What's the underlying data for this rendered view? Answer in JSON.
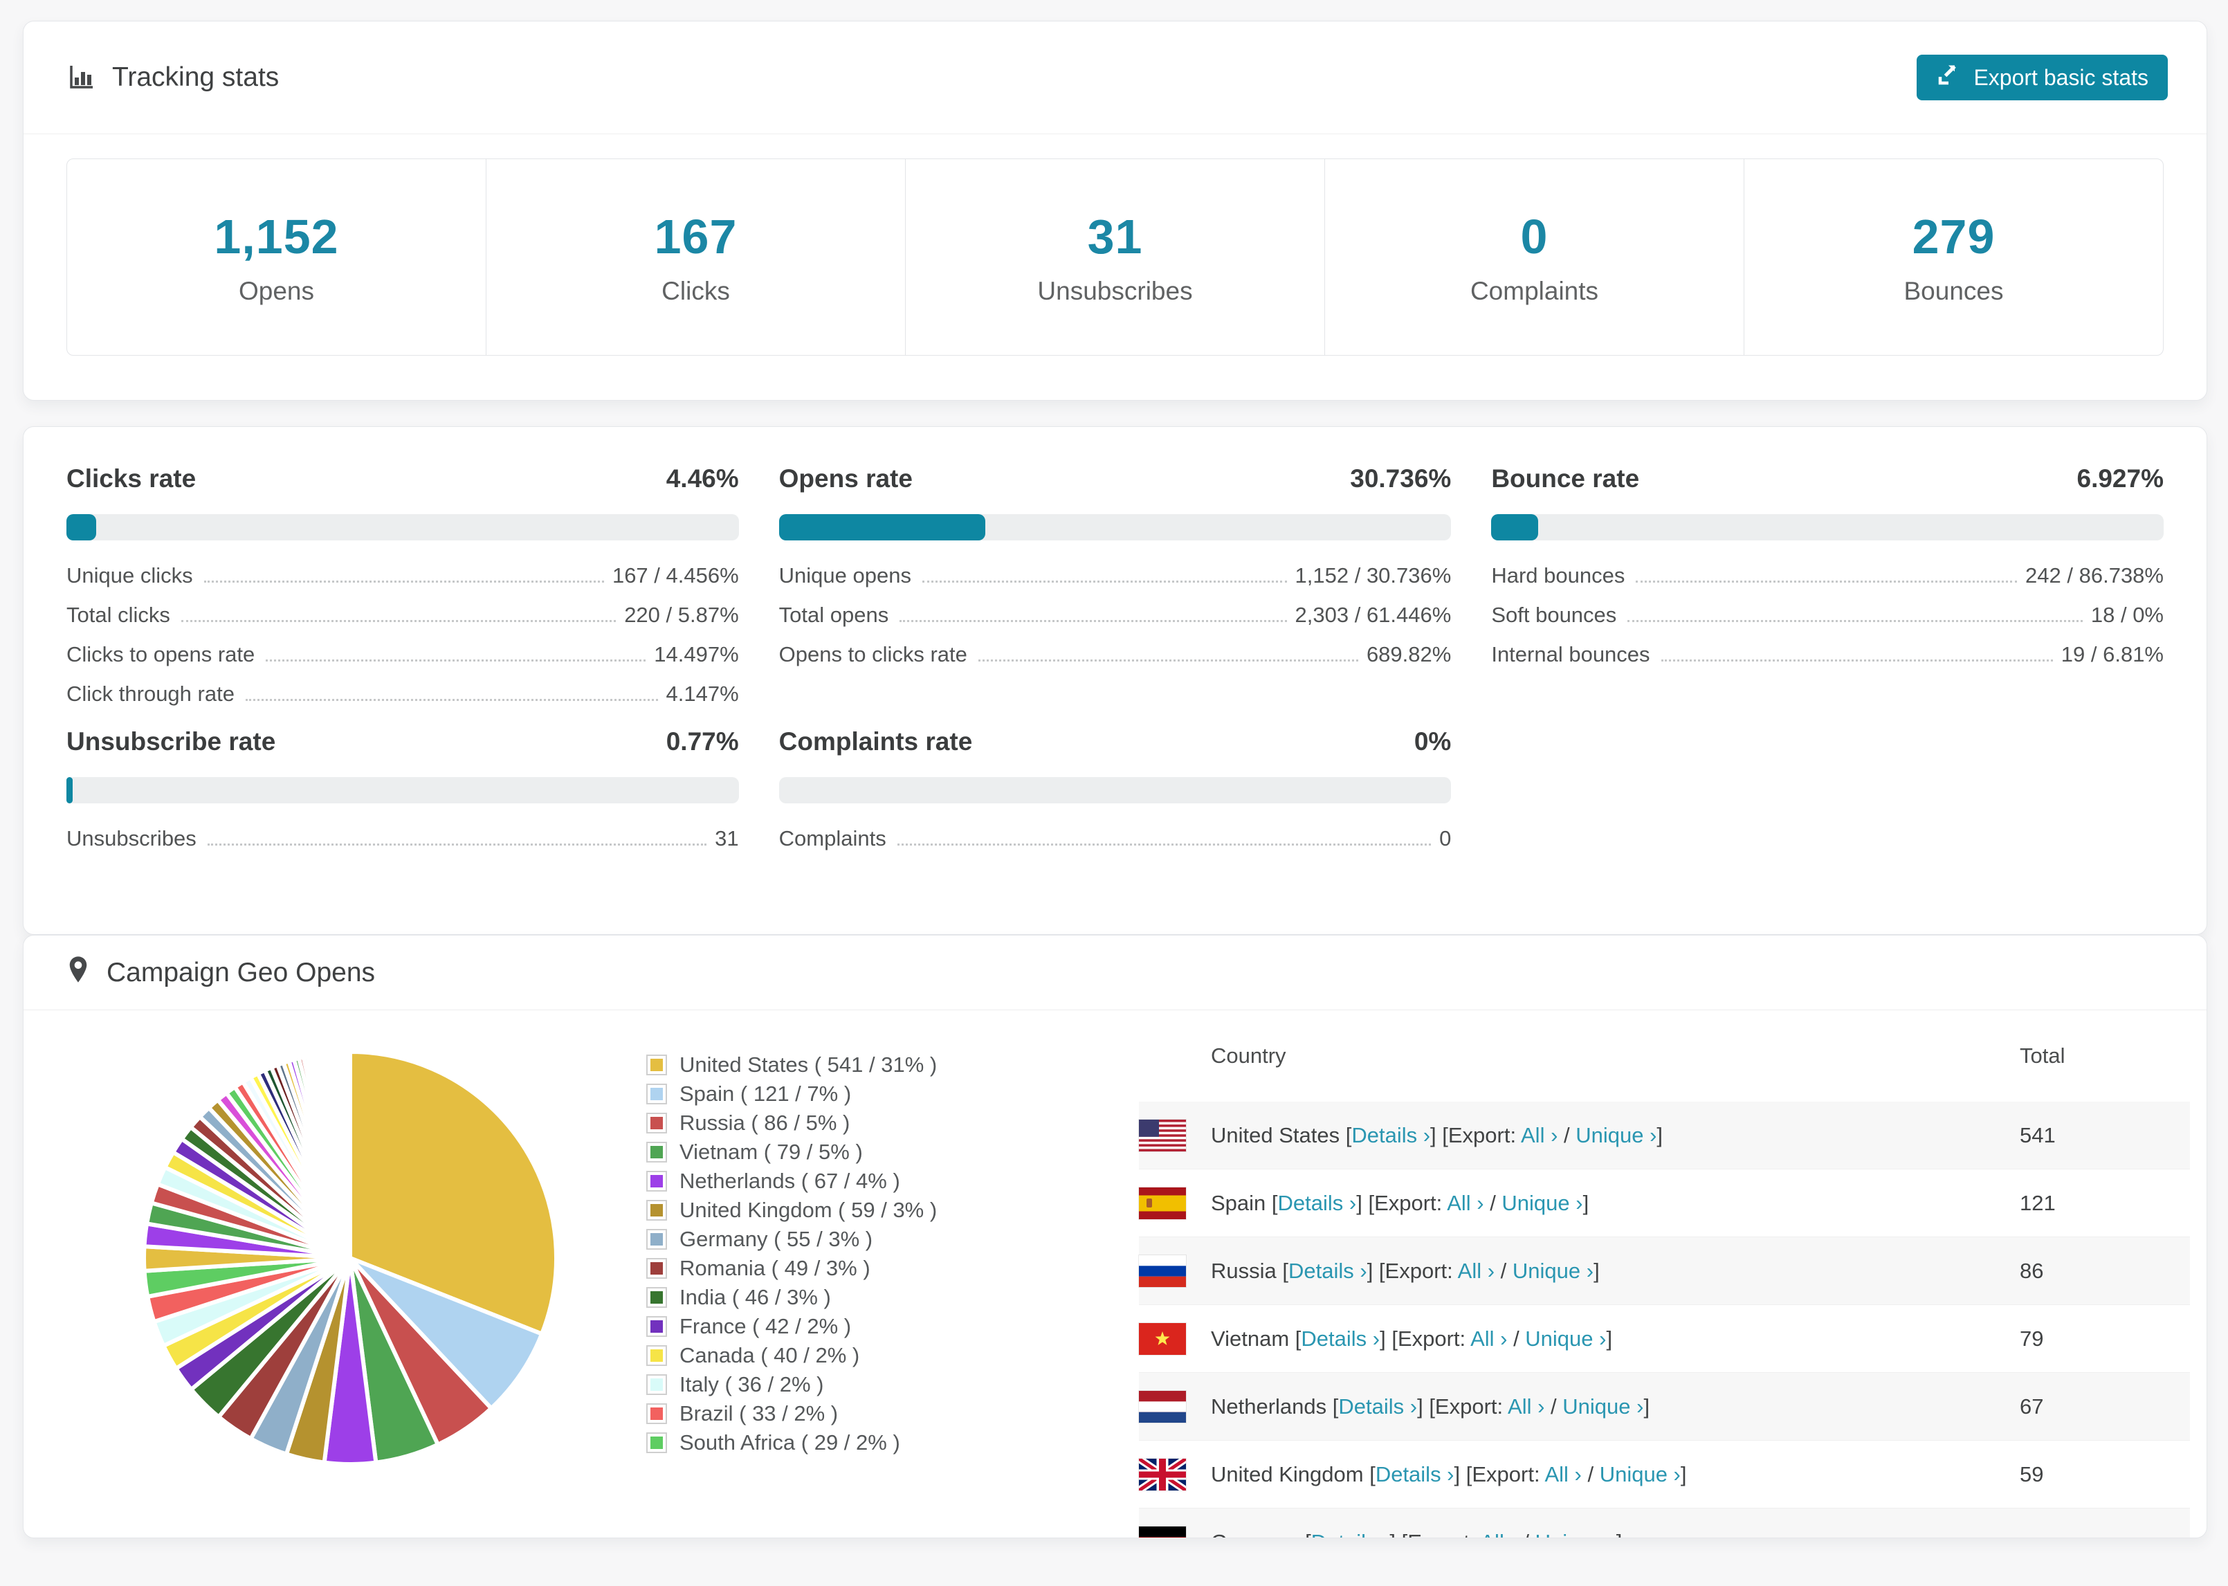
{
  "colors": {
    "accent": "#1B87A5",
    "button": "#0E87A2",
    "link": "#2A96B1",
    "bar_track": "#ECEEEF",
    "stripe_row": "#F7F7F7"
  },
  "tracking": {
    "title": "Tracking stats",
    "export_button": "Export basic stats",
    "summary": [
      {
        "value": "1,152",
        "label": "Opens"
      },
      {
        "value": "167",
        "label": "Clicks"
      },
      {
        "value": "31",
        "label": "Unsubscribes"
      },
      {
        "value": "0",
        "label": "Complaints"
      },
      {
        "value": "279",
        "label": "Bounces"
      }
    ]
  },
  "rates": [
    {
      "title": "Clicks rate",
      "value": "4.46%",
      "bar_percent": 4.46,
      "rows": [
        {
          "label": "Unique clicks",
          "value": "167 / 4.456%"
        },
        {
          "label": "Total clicks",
          "value": "220 / 5.87%"
        },
        {
          "label": "Clicks to opens rate",
          "value": "14.497%"
        },
        {
          "label": "Click through rate",
          "value": "4.147%"
        }
      ]
    },
    {
      "title": "Opens rate",
      "value": "30.736%",
      "bar_percent": 30.736,
      "rows": [
        {
          "label": "Unique opens",
          "value": "1,152 / 30.736%"
        },
        {
          "label": "Total opens",
          "value": "2,303 / 61.446%"
        },
        {
          "label": "Opens to clicks rate",
          "value": "689.82%"
        }
      ]
    },
    {
      "title": "Bounce rate",
      "value": "6.927%",
      "bar_percent": 6.927,
      "rows": [
        {
          "label": "Hard bounces",
          "value": "242 / 86.738%"
        },
        {
          "label": "Soft bounces",
          "value": "18 / 0%"
        },
        {
          "label": "Internal bounces",
          "value": "19 / 6.81%"
        }
      ]
    },
    {
      "title": "Unsubscribe rate",
      "value": "0.77%",
      "bar_percent": 0.77,
      "rows": [
        {
          "label": "Unsubscribes",
          "value": "31"
        }
      ]
    },
    {
      "title": "Complaints rate",
      "value": "0%",
      "bar_percent": 0,
      "rows": [
        {
          "label": "Complaints",
          "value": "0"
        }
      ]
    }
  ],
  "geo": {
    "title": "Campaign Geo Opens",
    "chart_data": {
      "type": "pie",
      "title": "Campaign Geo Opens",
      "legend_position": "right",
      "slices": [
        {
          "label": "United States",
          "count": 541,
          "percent": 31,
          "color": "#E4BE41",
          "flag": "us"
        },
        {
          "label": "Spain",
          "count": 121,
          "percent": 7,
          "color": "#AFD3F0",
          "flag": "es"
        },
        {
          "label": "Russia",
          "count": 86,
          "percent": 5,
          "color": "#C8504F",
          "flag": "ru"
        },
        {
          "label": "Vietnam",
          "count": 79,
          "percent": 5,
          "color": "#4FA553",
          "flag": "vn"
        },
        {
          "label": "Netherlands",
          "count": 67,
          "percent": 4,
          "color": "#9D3FE8",
          "flag": "nl"
        },
        {
          "label": "United Kingdom",
          "count": 59,
          "percent": 3,
          "color": "#B5922F",
          "flag": "gb"
        },
        {
          "label": "Germany",
          "count": 55,
          "percent": 3,
          "color": "#8FAFC9",
          "flag": "de"
        },
        {
          "label": "Romania",
          "count": 49,
          "percent": 3,
          "color": "#9E3F3C",
          "flag": "ro"
        },
        {
          "label": "India",
          "count": 46,
          "percent": 3,
          "color": "#37752F",
          "flag": "in"
        },
        {
          "label": "France",
          "count": 42,
          "percent": 2,
          "color": "#7231BE",
          "flag": "fr"
        },
        {
          "label": "Canada",
          "count": 40,
          "percent": 2,
          "color": "#F6E447",
          "flag": "ca"
        },
        {
          "label": "Italy",
          "count": 36,
          "percent": 2,
          "color": "#D9FBF9",
          "flag": "it"
        },
        {
          "label": "Brazil",
          "count": 33,
          "percent": 2,
          "color": "#F2615F",
          "flag": "br"
        },
        {
          "label": "South Africa",
          "count": 29,
          "percent": 2,
          "color": "#5ECD62",
          "flag": "za"
        }
      ],
      "others_percent_total": 26
    },
    "table": {
      "headers": [
        "Country",
        "Total"
      ],
      "link_labels": {
        "details": "Details ›",
        "export": "Export:",
        "all": "All ›",
        "unique": "Unique ›"
      },
      "rows": [
        {
          "country": "United States",
          "flag": "us",
          "total": "541"
        },
        {
          "country": "Spain",
          "flag": "es",
          "total": "121"
        },
        {
          "country": "Russia",
          "flag": "ru",
          "total": "86"
        },
        {
          "country": "Vietnam",
          "flag": "vn",
          "total": "79"
        },
        {
          "country": "Netherlands",
          "flag": "nl",
          "total": "67"
        },
        {
          "country": "United Kingdom",
          "flag": "gb",
          "total": "59"
        },
        {
          "country": "Germany",
          "flag": "de",
          "total": ""
        }
      ]
    }
  }
}
